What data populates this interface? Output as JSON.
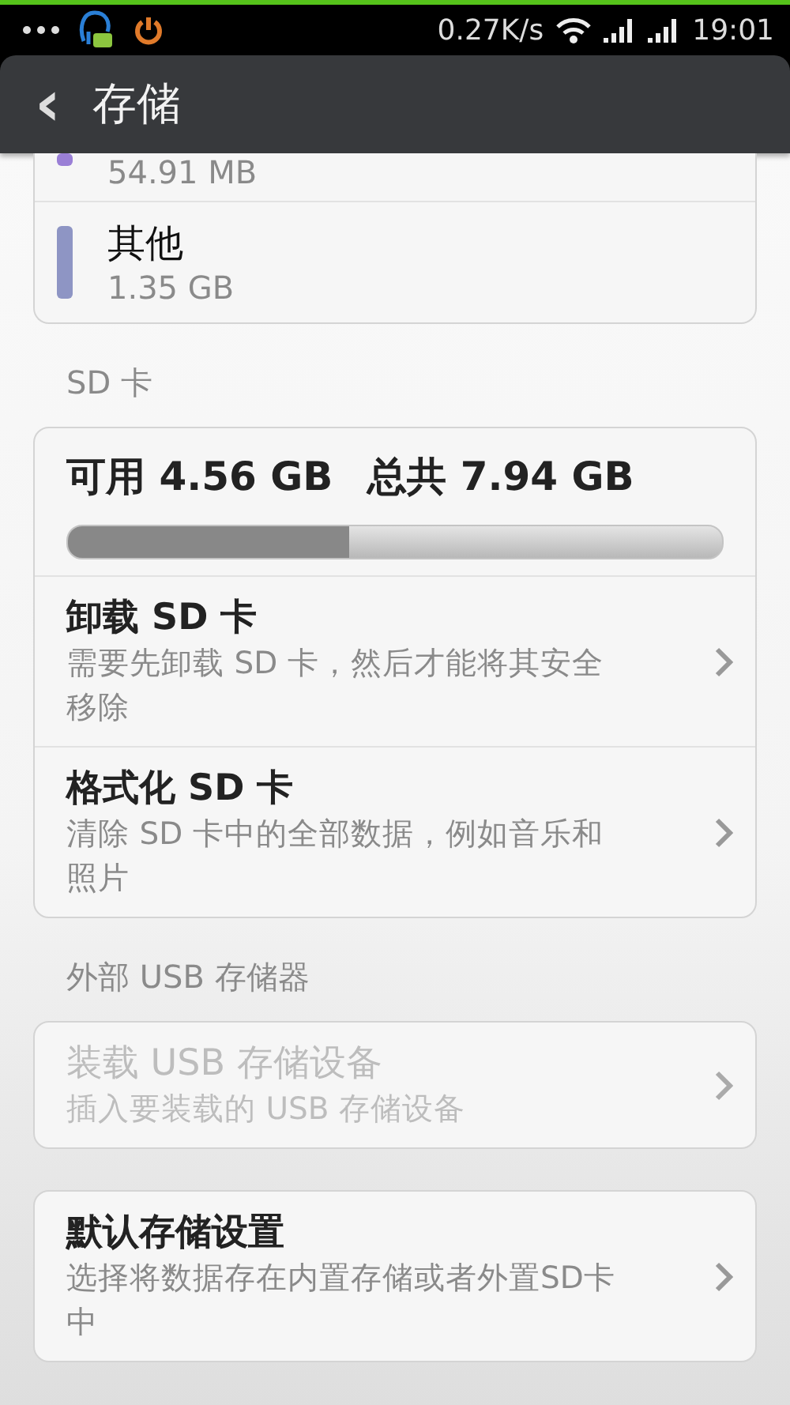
{
  "status_bar": {
    "network_speed": "0.27K/s",
    "time": "19:01"
  },
  "header": {
    "back": "‹",
    "title": "存储"
  },
  "sections": [
    {
      "cards": [
        {
          "rows": [
            {
              "kind": "category",
              "value": "54.91 MB",
              "color": "#9a7fd6"
            },
            {
              "kind": "category",
              "name": "其他",
              "value": "1.35 GB",
              "color": "#8e95c4"
            }
          ]
        }
      ]
    },
    {
      "heading": "SD 卡",
      "cards": [
        {
          "rows": [
            {
              "kind": "usage",
              "available": "可用 4.56 GB",
              "total": "总共 7.94 GB",
              "level": 0.43
            },
            {
              "kind": "action",
              "title": "卸载 SD 卡",
              "subtitle": "需要先卸载 SD 卡，然后才能将其安全移除",
              "disabled": false
            },
            {
              "kind": "action",
              "title": "格式化 SD 卡",
              "subtitle": "清除 SD 卡中的全部数据，例如音乐和照片",
              "disabled": false
            }
          ]
        }
      ]
    },
    {
      "heading": "外部 USB 存储器",
      "cards": [
        {
          "rows": [
            {
              "kind": "action",
              "title": "装载 USB 存储设备",
              "subtitle": "插入要装载的 USB 存储设备",
              "disabled": true
            }
          ]
        },
        {
          "rows": [
            {
              "kind": "action",
              "title": "默认存储设置",
              "subtitle": "选择将数据存在内置存储或者外置SD卡中",
              "disabled": false
            }
          ]
        }
      ]
    }
  ]
}
